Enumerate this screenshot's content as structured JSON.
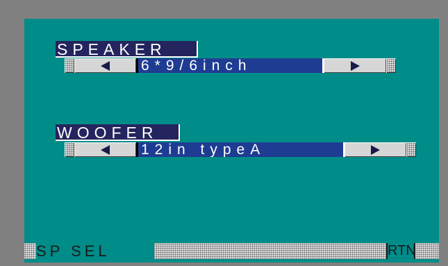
{
  "speaker": {
    "title": "SPEAKER",
    "value": "6*9/6inch"
  },
  "woofer": {
    "title": "WOOFER",
    "value": "12in typeA"
  },
  "statusbar": {
    "label": "SP SEL",
    "return_label": "RTN"
  },
  "colors": {
    "panel": "#008C88",
    "border": "#808080",
    "title_bg": "#24245E",
    "value_bg": "#1F3C93",
    "button": "#D6D6D6"
  }
}
